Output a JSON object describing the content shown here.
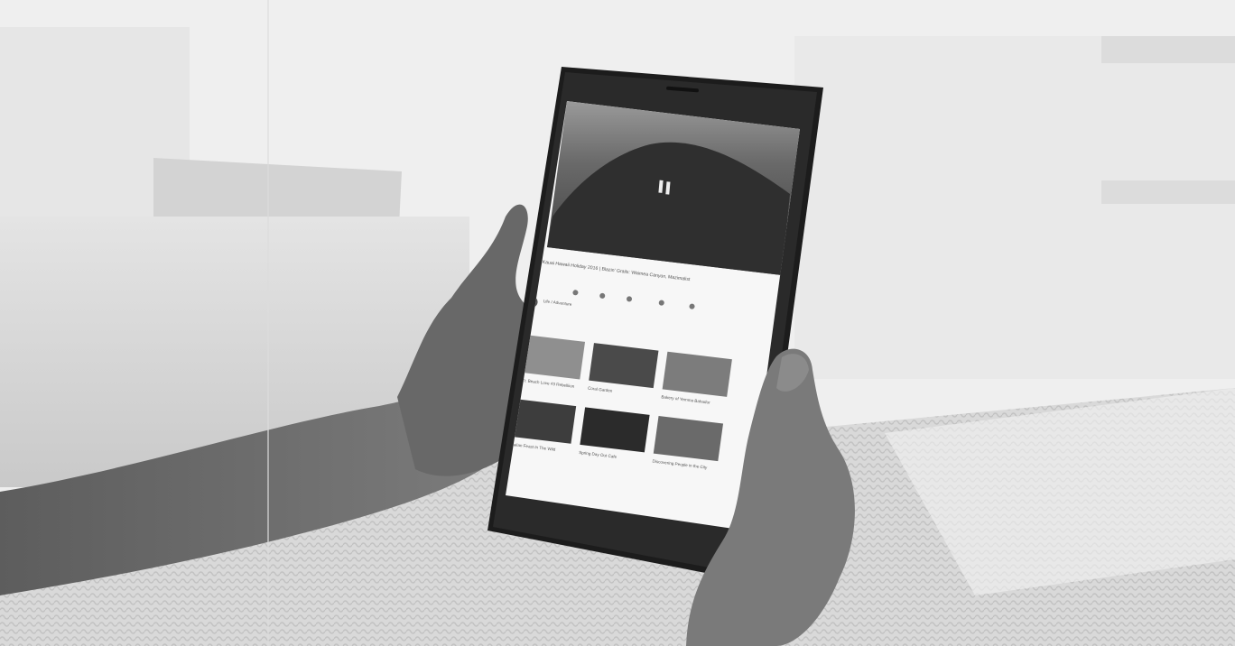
{
  "video": {
    "title": "Kauai Hawaii Holiday 2016 | Blazin' Grails: Waimea Canyon, Mazimalist"
  },
  "actions": [
    {
      "icon": "like-icon"
    },
    {
      "icon": "dislike-icon"
    },
    {
      "icon": "share-icon"
    },
    {
      "icon": "download-icon"
    },
    {
      "icon": "save-icon"
    }
  ],
  "channel": {
    "name": "Life / Adventure"
  },
  "thumbnails": [
    {
      "title": "Kaua'i: Beach Love #3 Rebelliion",
      "tone": "#8f8f8f"
    },
    {
      "title": "Coral Garden",
      "tone": "#4a4a4a"
    },
    {
      "title": "Bakery of Yemma Bahadur",
      "tone": "#7c7c7c"
    },
    {
      "title": "Hawaiian Feast In The Wild",
      "tone": "#3d3d3d"
    },
    {
      "title": "Spring Day Out Cafe",
      "tone": "#2b2b2b"
    },
    {
      "title": "Discovering People in the City",
      "tone": "#6a6a6a"
    }
  ]
}
